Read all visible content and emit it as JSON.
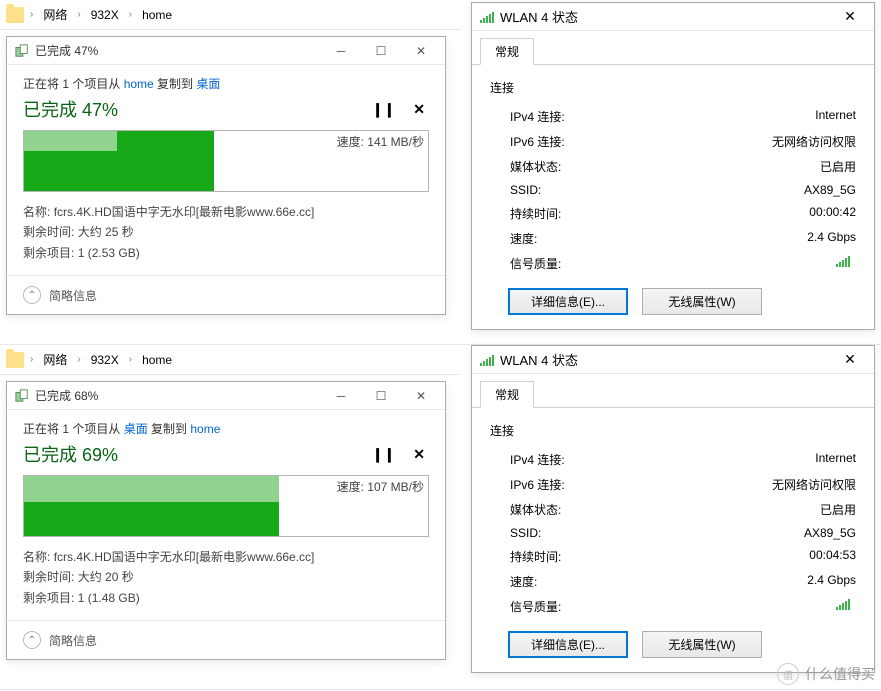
{
  "top": {
    "breadcrumb": {
      "root": "网络",
      "mid": "932X",
      "leaf": "home"
    },
    "copy": {
      "title": "已完成 47%",
      "action_pre": "正在将 1 个项目从 ",
      "action_src": "home",
      "action_mid": " 复制到 ",
      "action_dst": "桌面",
      "headline": "已完成 47%",
      "speed_label": "速度: 141 MB/秒",
      "area_pct": 47,
      "fill_top_h": 22,
      "fill_bot_h1": 30,
      "fill_bot_h2": 44,
      "name_k": "名称:",
      "name_v": "fcrs.4K.HD国语中字无水印[最新电影www.66e.cc]",
      "remain_k": "剩余时间:",
      "remain_v": "大约 25 秒",
      "items_k": "剩余项目:",
      "items_v": "1 (2.53 GB)",
      "brief": "简略信息"
    },
    "wlan": {
      "title": "WLAN 4 状态",
      "tab": "常规",
      "group": "连接",
      "rows": {
        "ipv4_k": "IPv4 连接:",
        "ipv4_v": "Internet",
        "ipv6_k": "IPv6 连接:",
        "ipv6_v": "无网络访问权限",
        "media_k": "媒体状态:",
        "media_v": "已启用",
        "ssid_k": "SSID:",
        "ssid_v": "AX89_5G",
        "dur_k": "持续时间:",
        "dur_v": "00:00:42",
        "spd_k": "速度:",
        "spd_v": "2.4 Gbps",
        "sig_k": "信号质量:"
      },
      "btn1": "详细信息(E)...",
      "btn2": "无线属性(W)"
    }
  },
  "bottom": {
    "breadcrumb": {
      "root": "网络",
      "mid": "932X",
      "leaf": "home"
    },
    "copy": {
      "title": "已完成 68%",
      "action_pre": "正在将 1 个项目从 ",
      "action_src": "桌面",
      "action_mid": " 复制到 ",
      "action_dst": "home",
      "headline": "已完成 69%",
      "speed_label": "速度: 107 MB/秒",
      "area_pct": 63,
      "fill_bot_h1": 34,
      "fill_bot_h2": 34,
      "name_k": "名称:",
      "name_v": "fcrs.4K.HD国语中字无水印[最新电影www.66e.cc]",
      "remain_k": "剩余时间:",
      "remain_v": "大约 20 秒",
      "items_k": "剩余项目:",
      "items_v": "1 (1.48 GB)",
      "brief": "简略信息"
    },
    "wlan": {
      "title": "WLAN 4 状态",
      "tab": "常规",
      "group": "连接",
      "rows": {
        "ipv4_k": "IPv4 连接:",
        "ipv4_v": "Internet",
        "ipv6_k": "IPv6 连接:",
        "ipv6_v": "无网络访问权限",
        "media_k": "媒体状态:",
        "media_v": "已启用",
        "ssid_k": "SSID:",
        "ssid_v": "AX89_5G",
        "dur_k": "持续时间:",
        "dur_v": "00:04:53",
        "spd_k": "速度:",
        "spd_v": "2.4 Gbps",
        "sig_k": "信号质量:"
      },
      "btn1": "详细信息(E)...",
      "btn2": "无线属性(W)"
    }
  },
  "watermark": "什么值得买"
}
